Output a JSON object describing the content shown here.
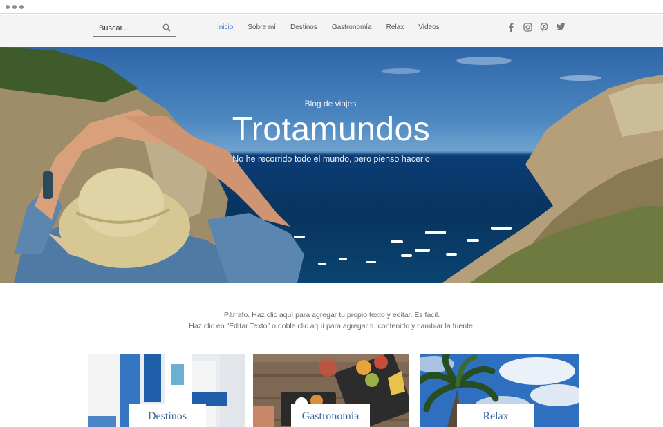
{
  "header": {
    "search": {
      "placeholder": "Buscar..."
    },
    "nav": [
      {
        "label": "Inicio",
        "active": true
      },
      {
        "label": "Sobre mí"
      },
      {
        "label": "Destinos"
      },
      {
        "label": "Gastronomía"
      },
      {
        "label": "Relax"
      },
      {
        "label": "Videos"
      }
    ],
    "social": [
      "facebook-icon",
      "instagram-icon",
      "pinterest-icon",
      "twitter-icon"
    ]
  },
  "hero": {
    "subtitle": "Blog de viajes",
    "title": "Trotamundos",
    "tagline": "No he recorrido todo el mundo, pero pienso hacerlo"
  },
  "intro": {
    "line1": "Párrafo. Haz clic aquí para agregar tu propio texto y editar. Es fácil.",
    "line2": "Haz clic en \"Editar Texto\" o doble clic aquí para agregar tu contenido y cambiar la fuente."
  },
  "cards": [
    {
      "label": "Destinos"
    },
    {
      "label": "Gastronomía"
    },
    {
      "label": "Relax"
    }
  ],
  "colors": {
    "accent": "#4a7ac7",
    "card_label": "#3b6aa0",
    "header_bg": "#f4f4f4"
  }
}
